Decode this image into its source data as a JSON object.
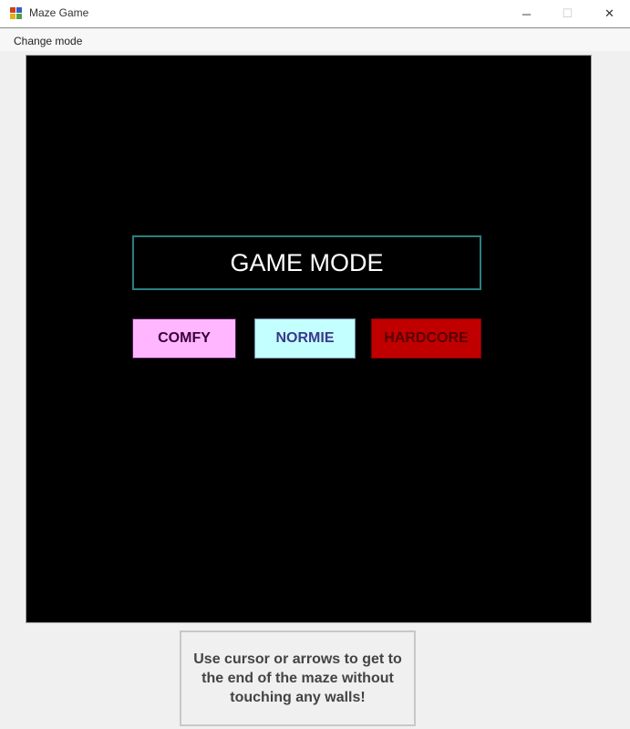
{
  "window": {
    "title": "Maze Game",
    "minimize_glyph": "─",
    "maximize_glyph": "☐",
    "close_glyph": "✕"
  },
  "menu": {
    "change_mode": "Change mode"
  },
  "game": {
    "mode_title": "GAME MODE",
    "buttons": {
      "comfy": "COMFY",
      "normie": "NORMIE",
      "hardcore": "HARDCORE"
    }
  },
  "instructions": "Use cursor or arrows to get to the end of the maze without touching any walls!",
  "colors": {
    "comfy": "#ffb6ff",
    "normie": "#c4ffff",
    "hardcore": "#c00000",
    "title_border": "#2a7f80"
  }
}
